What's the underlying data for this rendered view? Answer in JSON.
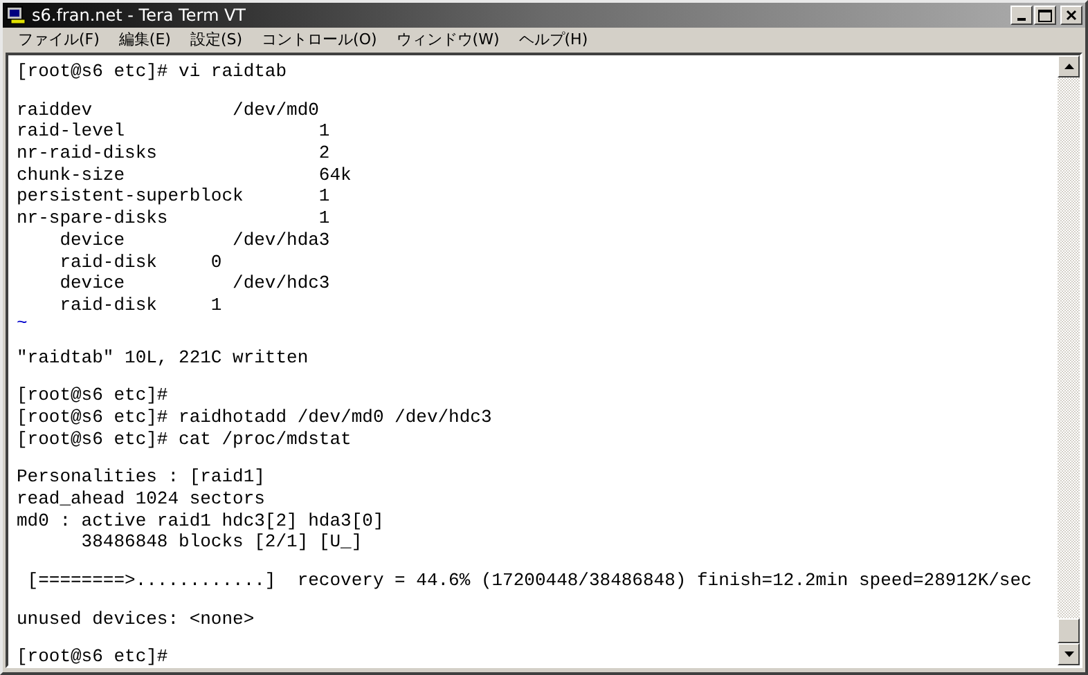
{
  "window": {
    "title": "s6.fran.net - Tera Term VT"
  },
  "menu": [
    "ファイル(F)",
    "編集(E)",
    "設定(S)",
    "コントロール(O)",
    "ウィンドウ(W)",
    "ヘルプ(H)"
  ],
  "terminal": {
    "lines": [
      {
        "kind": "text",
        "text": "[root@s6 etc]# vi raidtab"
      },
      {
        "kind": "blank"
      },
      {
        "kind": "text",
        "text": "raiddev             /dev/md0"
      },
      {
        "kind": "text",
        "text": "raid-level                  1"
      },
      {
        "kind": "text",
        "text": "nr-raid-disks               2"
      },
      {
        "kind": "text",
        "text": "chunk-size                  64k"
      },
      {
        "kind": "text",
        "text": "persistent-superblock       1"
      },
      {
        "kind": "text",
        "text": "nr-spare-disks              1"
      },
      {
        "kind": "text",
        "text": "    device          /dev/hda3"
      },
      {
        "kind": "text",
        "text": "    raid-disk     0"
      },
      {
        "kind": "text",
        "text": "    device          /dev/hdc3"
      },
      {
        "kind": "text",
        "text": "    raid-disk     1"
      },
      {
        "kind": "tilde",
        "text": "~"
      },
      {
        "kind": "blank"
      },
      {
        "kind": "text",
        "text": "\"raidtab\" 10L, 221C written"
      },
      {
        "kind": "blank"
      },
      {
        "kind": "text",
        "text": "[root@s6 etc]#"
      },
      {
        "kind": "text",
        "text": "[root@s6 etc]# raidhotadd /dev/md0 /dev/hdc3"
      },
      {
        "kind": "text",
        "text": "[root@s6 etc]# cat /proc/mdstat"
      },
      {
        "kind": "blank"
      },
      {
        "kind": "text",
        "text": "Personalities : [raid1]"
      },
      {
        "kind": "text",
        "text": "read_ahead 1024 sectors"
      },
      {
        "kind": "text",
        "text": "md0 : active raid1 hdc3[2] hda3[0]"
      },
      {
        "kind": "text",
        "text": "      38486848 blocks [2/1] [U_]"
      },
      {
        "kind": "blank"
      },
      {
        "kind": "text",
        "text": " [========>............]  recovery = 44.6% (17200448/38486848) finish=12.2min speed=28912K/sec"
      },
      {
        "kind": "blank"
      },
      {
        "kind": "text",
        "text": "unused devices: <none>"
      },
      {
        "kind": "blank"
      },
      {
        "kind": "text",
        "text": "[root@s6 etc]#"
      }
    ]
  }
}
